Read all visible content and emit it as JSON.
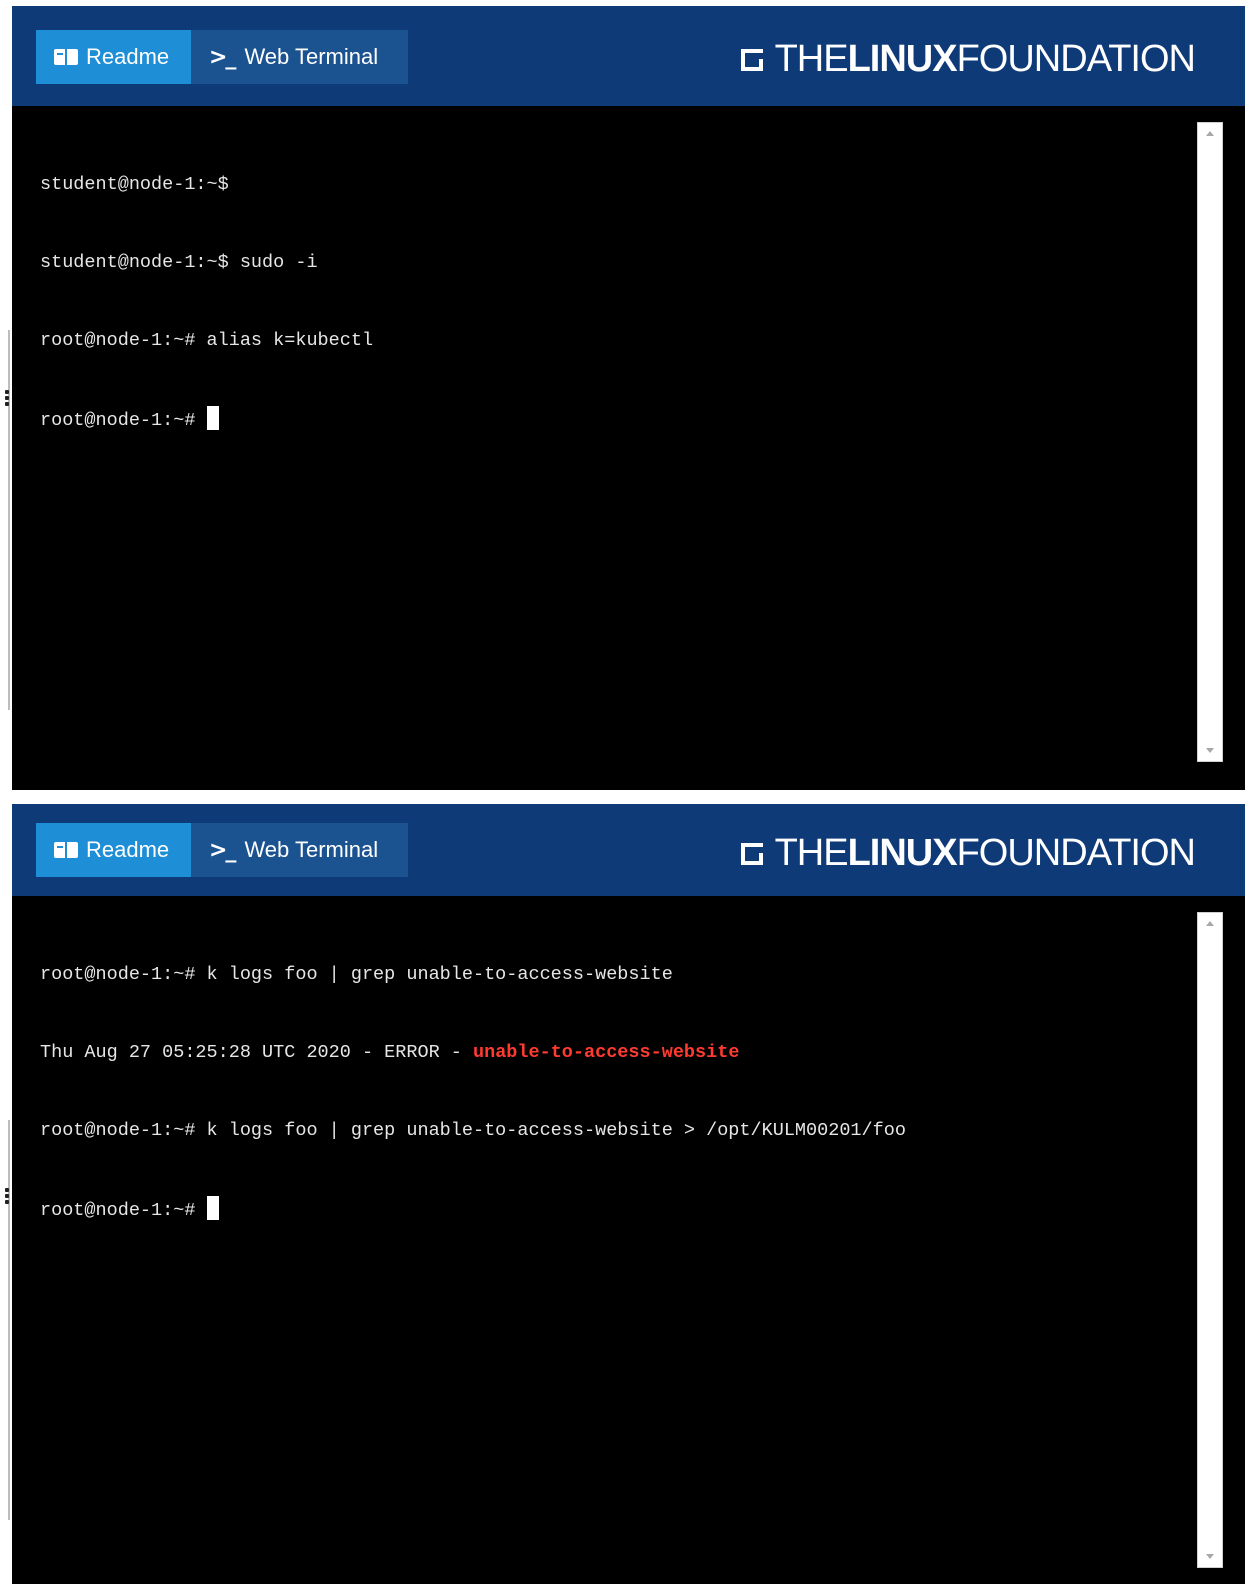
{
  "panels": [
    {
      "tabs": {
        "readme": "Readme",
        "terminal": "Web Terminal"
      },
      "logo": {
        "the": "THE",
        "linux": "LINUX",
        "foundation": "FOUNDATION"
      },
      "terminal_lines": [
        "student@node-1:~$",
        "student@node-1:~$ sudo -i",
        "root@node-1:~# alias k=kubectl",
        "root@node-1:~# "
      ]
    },
    {
      "tabs": {
        "readme": "Readme",
        "terminal": "Web Terminal"
      },
      "logo": {
        "the": "THE",
        "linux": "LINUX",
        "foundation": "FOUNDATION"
      },
      "terminal_lines": [
        "root@node-1:~# k logs foo | grep unable-to-access-website",
        "Thu Aug 27 05:25:28 UTC 2020 - ERROR - ",
        "root@node-1:~# k logs foo | grep unable-to-access-website > /opt/KULM00201/foo",
        "root@node-1:~# "
      ],
      "error_highlight": "unable-to-access-website"
    }
  ],
  "colors": {
    "header_bg": "#0e3a78",
    "readme_tab": "#1e8fd6",
    "terminal_tab": "#1b5391",
    "terminal_bg": "#000000",
    "error_text": "#ff3b30"
  }
}
